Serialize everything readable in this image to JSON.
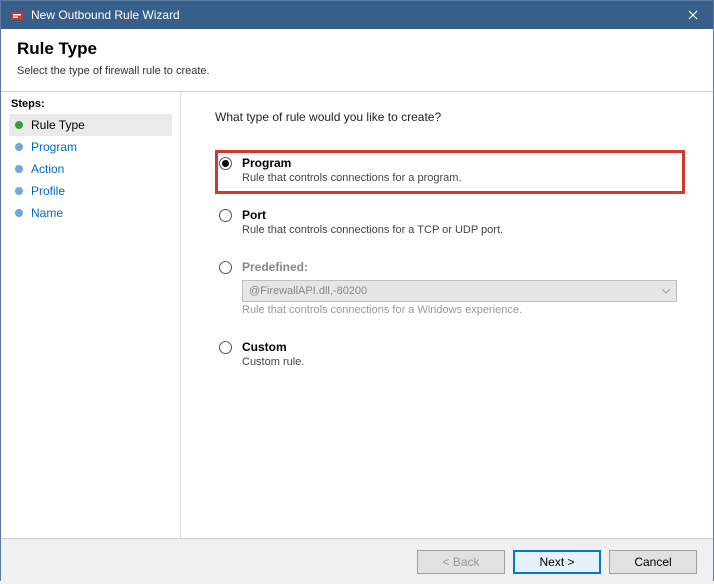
{
  "window": {
    "title": "New Outbound Rule Wizard"
  },
  "header": {
    "title": "Rule Type",
    "subtitle": "Select the type of firewall rule to create."
  },
  "sidebar": {
    "title": "Steps:",
    "items": [
      {
        "label": "Rule Type",
        "current": true
      },
      {
        "label": "Program",
        "current": false
      },
      {
        "label": "Action",
        "current": false
      },
      {
        "label": "Profile",
        "current": false
      },
      {
        "label": "Name",
        "current": false
      }
    ]
  },
  "content": {
    "question": "What type of rule would you like to create?",
    "options": [
      {
        "title": "Program",
        "desc": "Rule that controls connections for a program.",
        "selected": true,
        "highlighted": true
      },
      {
        "title": "Port",
        "desc": "Rule that controls connections for a TCP or UDP port.",
        "selected": false
      },
      {
        "title": "Predefined:",
        "desc": "Rule that controls connections for a Windows experience.",
        "selected": false,
        "hasSelect": true,
        "selectValue": "@FirewallAPI.dll,-80200",
        "disabled": true
      },
      {
        "title": "Custom",
        "desc": "Custom rule.",
        "selected": false
      }
    ]
  },
  "footer": {
    "back": "< Back",
    "next": "Next >",
    "cancel": "Cancel"
  }
}
